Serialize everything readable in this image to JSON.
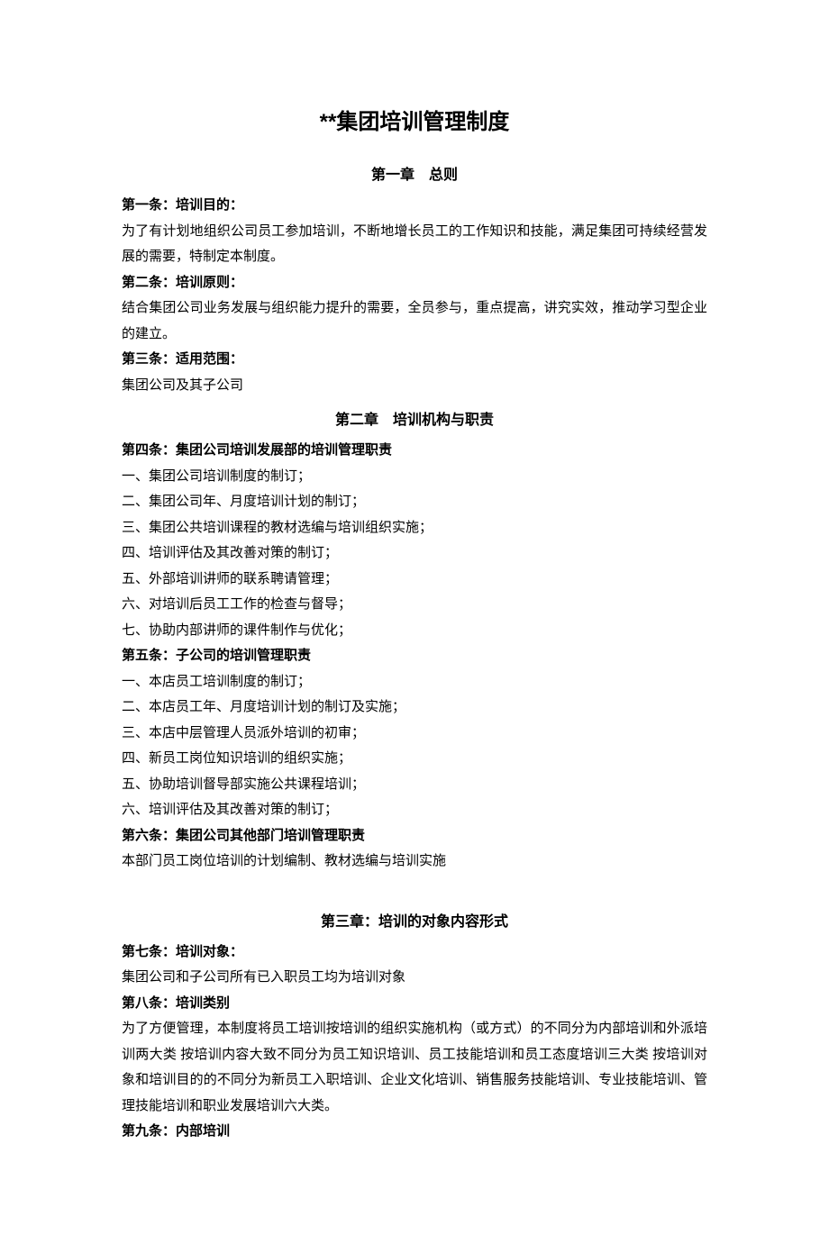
{
  "title": "**集团培训管理制度",
  "chapter1": {
    "heading": "第一章　总则",
    "a1_title": "第一条：培训目的：",
    "a1_body": "为了有计划地组织公司员工参加培训，不断地增长员工的工作知识和技能，满足集团可持续经营发展的需要，特制定本制度。",
    "a2_title": "第二条：培训原则：",
    "a2_body": "结合集团公司业务发展与组织能力提升的需要，全员参与，重点提高，讲究实效，推动学习型企业的建立。",
    "a3_title": "第三条：适用范围：",
    "a3_body": "集团公司及其子公司"
  },
  "chapter2": {
    "heading": "第二章　培训机构与职责",
    "a4_title": "第四条：集团公司培训发展部的培训管理职责",
    "a4_items": [
      "一、集团公司培训制度的制订；",
      "二、集团公司年、月度培训计划的制订；",
      "三、集团公共培训课程的教材选编与培训组织实施；",
      "四、培训评估及其改善对策的制订；",
      "五、外部培训讲师的联系聘请管理；",
      "六、对培训后员工工作的检查与督导；",
      "七、协助内部讲师的课件制作与优化；"
    ],
    "a5_title": "第五条：子公司的培训管理职责",
    "a5_items": [
      "一、本店员工培训制度的制订；",
      "二、本店员工年、月度培训计划的制订及实施；",
      "三、本店中层管理人员派外培训的初审；",
      "四、新员工岗位知识培训的组织实施；",
      "五、协助培训督导部实施公共课程培训；",
      "六、培训评估及其改善对策的制订；"
    ],
    "a6_title": "第六条：集团公司其他部门培训管理职责",
    "a6_body": "本部门员工岗位培训的计划编制、教材选编与培训实施"
  },
  "chapter3": {
    "heading": "第三章：培训的对象内容形式",
    "a7_title": "第七条：培训对象：",
    "a7_body": "集团公司和子公司所有已入职员工均为培训对象",
    "a8_title": "第八条：培训类别",
    "a8_body": "为了方便管理，本制度将员工培训按培训的组织实施机构（或方式）的不同分为内部培训和外派培训两大类 按培训内容大致不同分为员工知识培训、员工技能培训和员工态度培训三大类 按培训对象和培训目的的不同分为新员工入职培训、企业文化培训、销售服务技能培训、专业技能培训、管理技能培训和职业发展培训六大类。",
    "a9_title": "第九条：内部培训"
  }
}
